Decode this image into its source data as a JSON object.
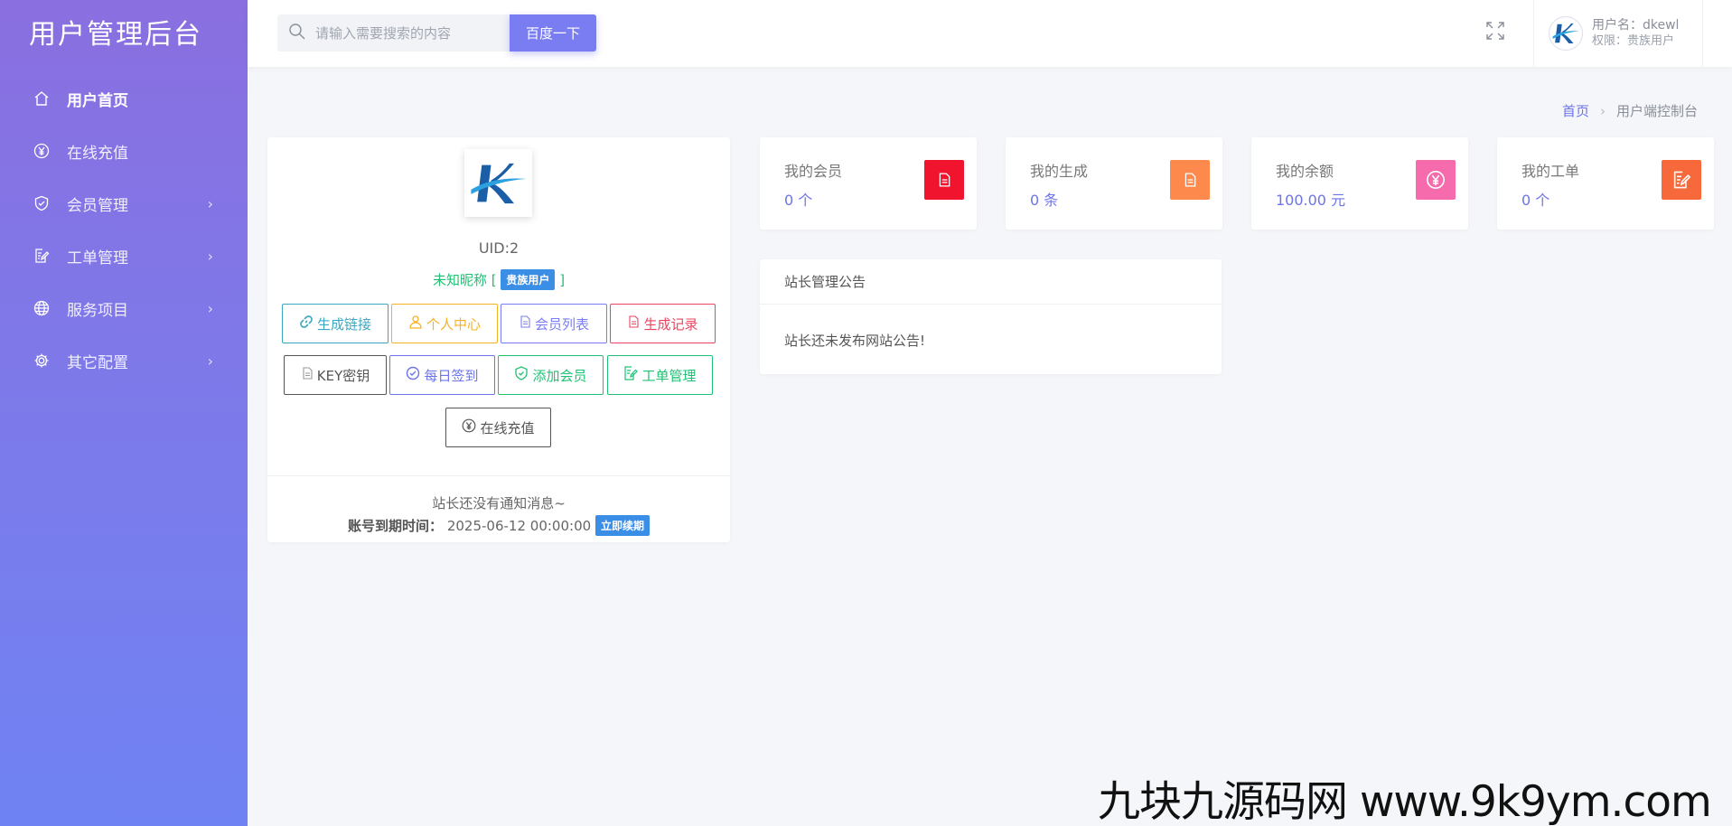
{
  "sidebar": {
    "brand": "用户管理后台",
    "items": [
      {
        "label": "用户首页",
        "icon": "home-icon",
        "active": true,
        "has_children": false
      },
      {
        "label": "在线充值",
        "icon": "yen-circle-icon",
        "active": false,
        "has_children": false
      },
      {
        "label": "会员管理",
        "icon": "shield-check-icon",
        "active": false,
        "has_children": true
      },
      {
        "label": "工单管理",
        "icon": "edit-doc-icon",
        "active": false,
        "has_children": true
      },
      {
        "label": "服务项目",
        "icon": "globe-icon",
        "active": false,
        "has_children": true
      },
      {
        "label": "其它配置",
        "icon": "gear-icon",
        "active": false,
        "has_children": true
      }
    ]
  },
  "topbar": {
    "search_placeholder": "请输入需要搜索的内容",
    "search_button": "百度一下",
    "user_name": "用户名：dkewl",
    "user_role": "权限：贵族用户"
  },
  "breadcrumb": {
    "home": "首页",
    "separator": "›",
    "current": "用户端控制台"
  },
  "profile": {
    "uid": "UID:2",
    "nickname": "未知昵称",
    "bracket_open": "[",
    "bracket_close": "]",
    "badge": "贵族用户",
    "buttons": [
      {
        "label": "生成链接",
        "icon": "link-icon",
        "color": "#3aa8c1"
      },
      {
        "label": "个人中心",
        "icon": "user-icon",
        "color": "#f5b225"
      },
      {
        "label": "会员列表",
        "icon": "doc-icon",
        "color": "#7a7df2"
      },
      {
        "label": "生成记录",
        "icon": "doc-icon",
        "color": "#ec4561"
      },
      {
        "label": "KEY密钥",
        "icon": "doc-icon",
        "color": "#555555"
      },
      {
        "label": "每日签到",
        "icon": "check-circle-icon",
        "color": "#6c74e8"
      },
      {
        "label": "添加会员",
        "icon": "shield-check-icon",
        "color": "#20c074"
      },
      {
        "label": "工单管理",
        "icon": "edit-doc-icon",
        "color": "#20c074"
      },
      {
        "label": "在线充值",
        "icon": "yen-circle-icon",
        "color": "#555555"
      }
    ],
    "notice": "站长还没有通知消息~",
    "expire_label": "账号到期时间：",
    "expire_value": "2025-06-12 00:00:00",
    "renew": "立即续期"
  },
  "stats": [
    {
      "label": "我的会员",
      "value": "0 个",
      "icon": "doc-icon",
      "color": "#f0142f"
    },
    {
      "label": "我的生成",
      "value": "0 条",
      "icon": "doc-icon",
      "color": "#fd8a4c"
    },
    {
      "label": "我的余额",
      "value": "100.00 元",
      "icon": "yen-circle-icon",
      "color": "#f56bac"
    },
    {
      "label": "我的工单",
      "value": "0 个",
      "icon": "edit-doc-icon",
      "color": "#f7693b"
    }
  ],
  "announcement": {
    "title": "站长管理公告",
    "body": "站长还未发布网站公告!"
  },
  "watermark": "九块九源码网 www.9k9ym.com"
}
